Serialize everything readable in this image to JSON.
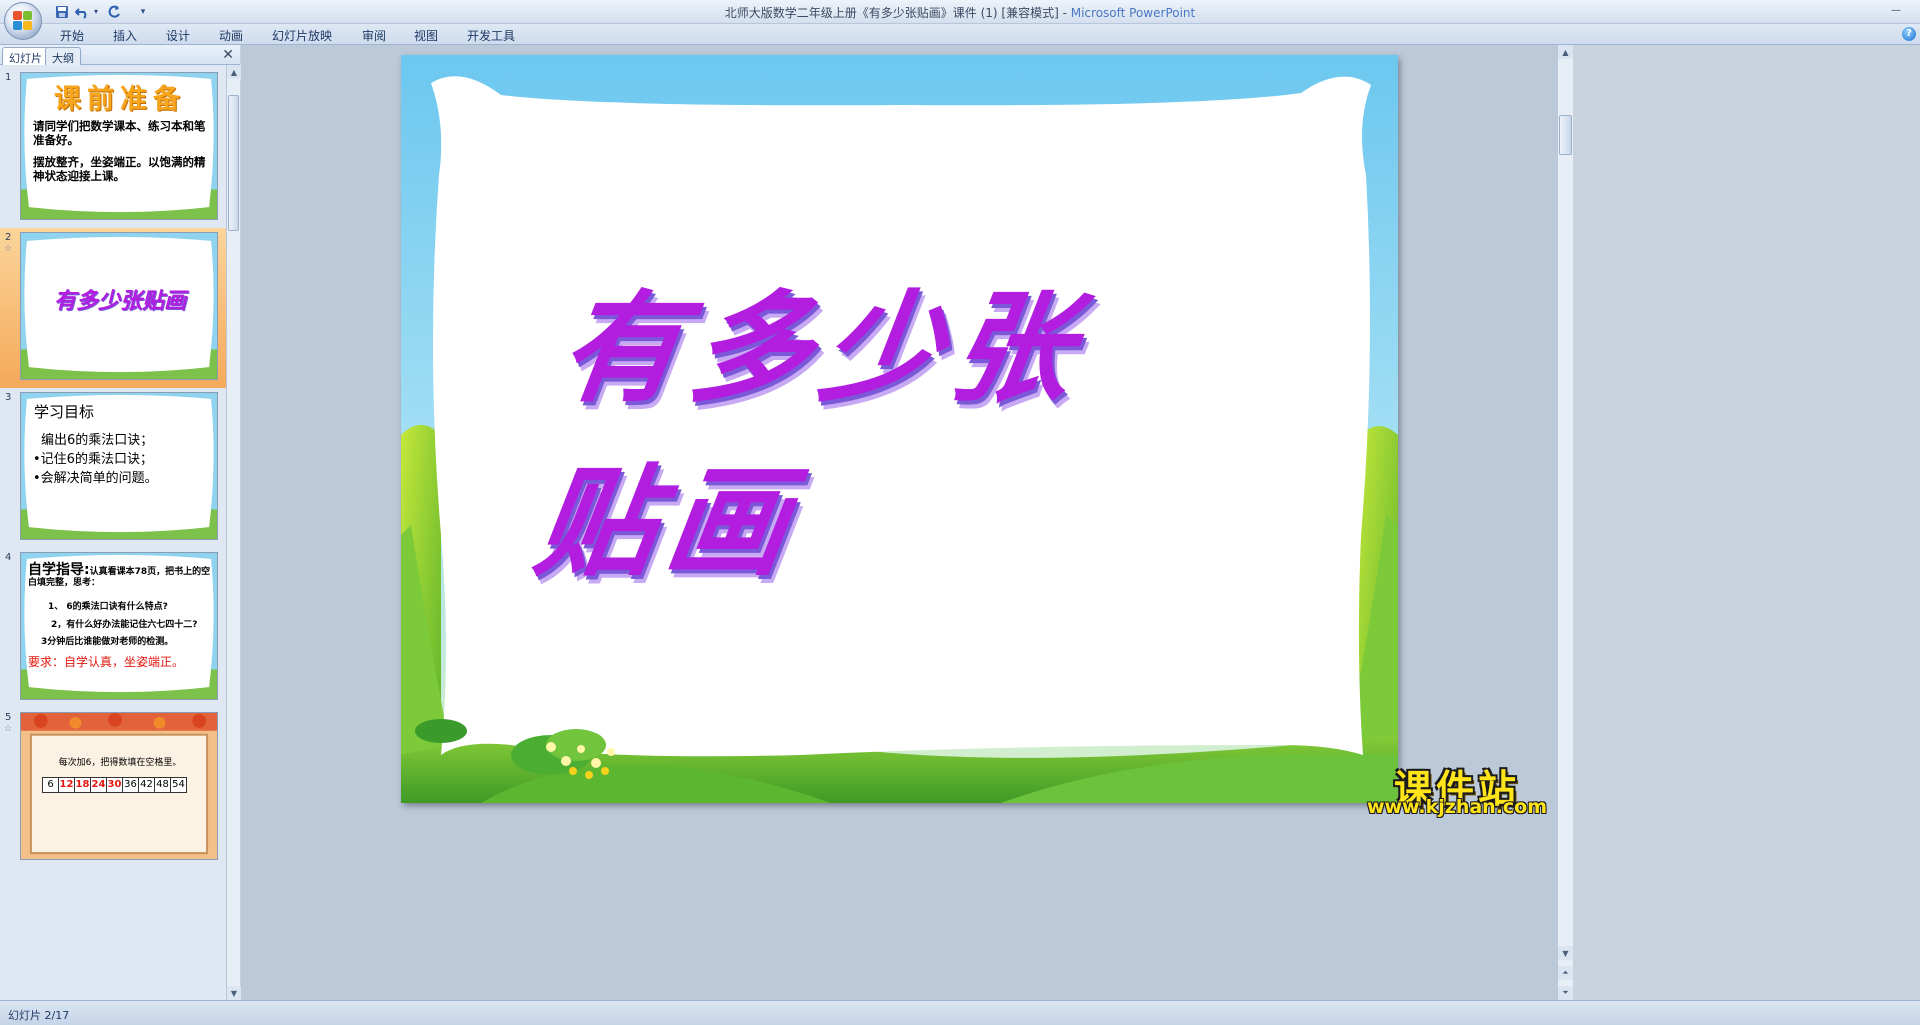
{
  "window": {
    "title": "北师大版数学二年级上册《有多少张贴画》课件 (1) [兼容模式]",
    "app_name": "Microsoft PowerPoint",
    "title_separator": " - ",
    "minimize_glyph": "—"
  },
  "quick_access": {
    "save_icon": "save-icon",
    "undo_icon": "undo-icon",
    "redo_icon": "redo-icon",
    "customize_icon": "customize-arrow-icon"
  },
  "ribbon": {
    "tabs": [
      "开始",
      "插入",
      "设计",
      "动画",
      "幻灯片放映",
      "审阅",
      "视图",
      "开发工具"
    ],
    "help_glyph": "?"
  },
  "left_panel": {
    "tabs": [
      "幻灯片",
      "大纲"
    ],
    "close_glyph": "✕",
    "slides": [
      {
        "number": "1",
        "title": "课前准备",
        "lines": [
          "请同学们把数学课本、练习本和笔准备好。",
          "摆放整齐，坐姿端正。以饱满的精神状态迎接上课。"
        ]
      },
      {
        "number": "2",
        "anim": "☆",
        "title": "有多少张贴画"
      },
      {
        "number": "3",
        "title": "学习目标",
        "lines": [
          "编出6的乘法口诀；",
          "•记住6的乘法口诀；",
          "•会解决简单的问题。"
        ]
      },
      {
        "number": "4",
        "title_strong": "自学指导:",
        "title_rest": "认真看课本78页，把书上的空白填完整，思考：",
        "lines": [
          "1、   6的乘法口诀有什么特点?",
          "2，有什么好办法能记住六七四十二?",
          "3分钟后比谁能做对老师的检测。"
        ],
        "requirement": "要求：自学认真，坐姿端正。"
      },
      {
        "number": "5",
        "anim": "☆",
        "instruction": "每次加6，把得数填在空格里。",
        "cells": [
          "6",
          "12",
          "18",
          "24",
          "30",
          "36",
          "42",
          "48",
          "54"
        ],
        "red_cells": [
          "12",
          "18",
          "24",
          "30"
        ]
      }
    ]
  },
  "main_slide": {
    "title": "有多少张贴画"
  },
  "watermark": {
    "name": "课件站",
    "url": "www.kjzhan.com"
  },
  "status": {
    "slide_indicator": "幻灯片 2/17"
  }
}
